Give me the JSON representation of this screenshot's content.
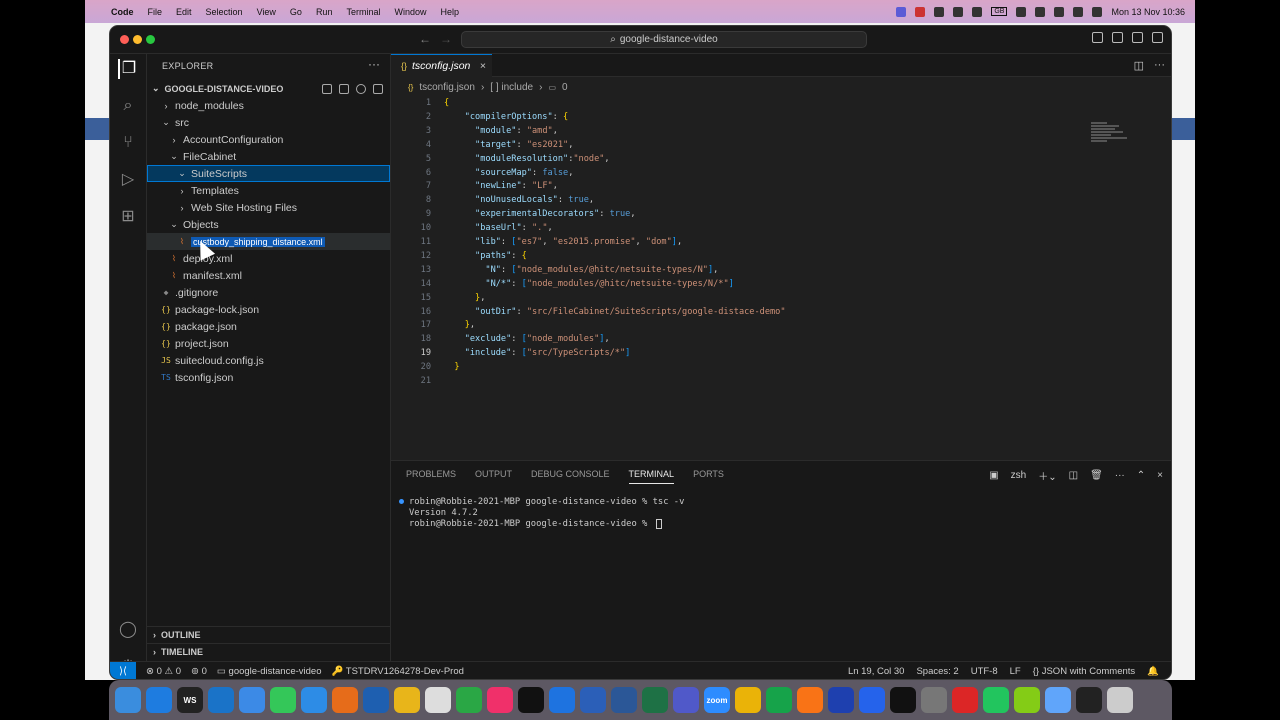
{
  "menubar": {
    "app": "Code",
    "items": [
      "File",
      "Edit",
      "Selection",
      "View",
      "Go",
      "Run",
      "Terminal",
      "Window",
      "Help"
    ],
    "clock": "Mon 13 Nov 10:36",
    "badge": "GB"
  },
  "window": {
    "search": "google-distance-video"
  },
  "explorer": {
    "title": "EXPLORER",
    "project": "GOOGLE-DISTANCE-VIDEO",
    "tree": [
      {
        "label": "node_modules",
        "chev": "›",
        "icon": "",
        "depth": 0
      },
      {
        "label": "src",
        "chev": "⌄",
        "icon": "",
        "depth": 0
      },
      {
        "label": "AccountConfiguration",
        "chev": "›",
        "icon": "",
        "depth": 1
      },
      {
        "label": "FileCabinet",
        "chev": "⌄",
        "icon": "",
        "depth": 1
      },
      {
        "label": "SuiteScripts",
        "chev": "⌄",
        "icon": "",
        "depth": 2
      },
      {
        "label": "Templates",
        "chev": "›",
        "icon": "",
        "depth": 2
      },
      {
        "label": "Web Site Hosting Files",
        "chev": "›",
        "icon": "",
        "depth": 2
      },
      {
        "label": "Objects",
        "chev": "⌄",
        "icon": "",
        "depth": 1
      },
      {
        "label": "custbody_shipping_distance.xml",
        "chev": "",
        "icon": "rss",
        "depth": 2
      },
      {
        "label": "deploy.xml",
        "chev": "",
        "icon": "rss",
        "depth": 1
      },
      {
        "label": "manifest.xml",
        "chev": "",
        "icon": "rss",
        "depth": 1
      },
      {
        "label": ".gitignore",
        "chev": "",
        "icon": "◆",
        "depth": 0
      },
      {
        "label": "package-lock.json",
        "chev": "",
        "icon": "{}",
        "depth": 0
      },
      {
        "label": "package.json",
        "chev": "",
        "icon": "{}",
        "depth": 0
      },
      {
        "label": "project.json",
        "chev": "",
        "icon": "{}",
        "depth": 0
      },
      {
        "label": "suitecloud.config.js",
        "chev": "",
        "icon": "JS",
        "depth": 0
      },
      {
        "label": "tsconfig.json",
        "chev": "",
        "icon": "TS",
        "depth": 0
      }
    ],
    "outline": "OUTLINE",
    "timeline": "TIMELINE"
  },
  "editor": {
    "tab": "tsconfig.json",
    "breadcrumb": [
      "tsconfig.json",
      "[ ] include",
      "0"
    ],
    "lines": [
      "{",
      "    \"compilerOptions\": {",
      "      \"module\": \"amd\",",
      "      \"target\": \"es2021\",",
      "      \"moduleResolution\":\"node\",",
      "      \"sourceMap\": false,",
      "      \"newLine\": \"LF\",",
      "      \"noUnusedLocals\": true,",
      "      \"experimentalDecorators\": true,",
      "      \"baseUrl\": \".\",",
      "      \"lib\": [\"es7\", \"es2015.promise\", \"dom\"],",
      "      \"paths\": {",
      "        \"N\": [\"node_modules/@hitc/netsuite-types/N\"],",
      "        \"N/*\": [\"node_modules/@hitc/netsuite-types/N/*\"]",
      "      },",
      "      \"outDir\": \"src/FileCabinet/SuiteScripts/google-distace-demo\"",
      "    },",
      "    \"exclude\": [\"node_modules\"],",
      "    \"include\": [\"src/TypeScripts/*\"]",
      "  }",
      ""
    ],
    "current_line": 19
  },
  "panel": {
    "tabs": [
      "PROBLEMS",
      "OUTPUT",
      "DEBUG CONSOLE",
      "TERMINAL",
      "PORTS"
    ],
    "active": "TERMINAL",
    "shell": "zsh",
    "terminal": [
      "robin@Robbie-2021-MBP google-distance-video % tsc -v",
      "Version 4.7.2",
      "robin@Robbie-2021-MBP google-distance-video % "
    ]
  },
  "status": {
    "errors": "0",
    "warnings": "0",
    "ports": "0",
    "folder": "google-distance-video",
    "account": "TSTDRV1264278-Dev-Prod",
    "position": "Ln 19, Col 30",
    "spaces": "Spaces: 2",
    "encoding": "UTF-8",
    "eol": "LF",
    "language": "JSON with Comments"
  },
  "dock": [
    "WS",
    "zoom"
  ]
}
